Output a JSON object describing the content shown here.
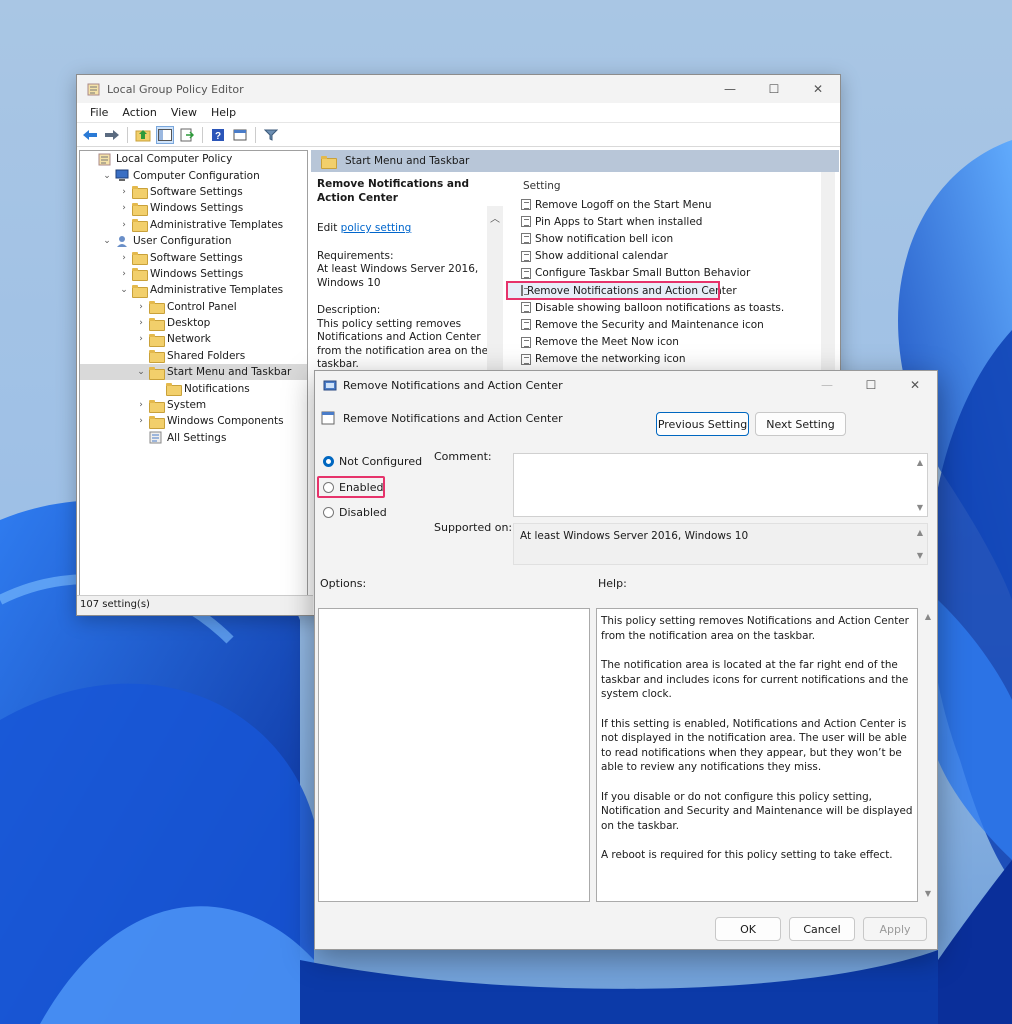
{
  "main_window": {
    "title": "Local Group Policy Editor",
    "menu": [
      "File",
      "Action",
      "View",
      "Help"
    ],
    "status": "107 setting(s)"
  },
  "tree": [
    {
      "label": "Local Computer Policy",
      "chev": "",
      "icon": "policy-icon"
    },
    {
      "label": "Computer Configuration",
      "chev": "⌄",
      "icon": "computer-icon"
    },
    {
      "label": "Software Settings",
      "chev": "›",
      "icon": "folder-icon"
    },
    {
      "label": "Windows Settings",
      "chev": "›",
      "icon": "folder-icon"
    },
    {
      "label": "Administrative Templates",
      "chev": "›",
      "icon": "folder-icon"
    },
    {
      "label": "User Configuration",
      "chev": "⌄",
      "icon": "user-icon"
    },
    {
      "label": "Software Settings",
      "chev": "›",
      "icon": "folder-icon"
    },
    {
      "label": "Windows Settings",
      "chev": "›",
      "icon": "folder-icon"
    },
    {
      "label": "Administrative Templates",
      "chev": "⌄",
      "icon": "folder-icon"
    },
    {
      "label": "Control Panel",
      "chev": "›",
      "icon": "folder-icon"
    },
    {
      "label": "Desktop",
      "chev": "›",
      "icon": "folder-icon"
    },
    {
      "label": "Network",
      "chev": "›",
      "icon": "folder-icon"
    },
    {
      "label": "Shared Folders",
      "chev": "",
      "icon": "folder-icon"
    },
    {
      "label": "Start Menu and Taskbar",
      "chev": "⌄",
      "icon": "folder-icon"
    },
    {
      "label": "Notifications",
      "chev": "",
      "icon": "folder-icon"
    },
    {
      "label": "System",
      "chev": "›",
      "icon": "folder-icon"
    },
    {
      "label": "Windows Components",
      "chev": "›",
      "icon": "folder-icon"
    },
    {
      "label": "All Settings",
      "chev": "",
      "icon": "settings-icon"
    }
  ],
  "right": {
    "header": "Start Menu and Taskbar",
    "desc_title": "Remove Notifications and Action Center",
    "edit_prefix": "Edit ",
    "edit_link": "policy setting",
    "req_label": "Requirements:",
    "req_text": "At least Windows Server 2016, Windows 10",
    "desc_label": "Description:",
    "desc_text": "This policy setting removes Notifications and Action Center from the notification area on the taskbar.",
    "list_header": "Setting",
    "settings": [
      "Remove Logoff on the Start Menu",
      "Pin Apps to Start when installed",
      "Show notification bell icon",
      "Show additional calendar",
      "Configure Taskbar Small Button Behavior",
      "Remove Notifications and Action Center",
      "Disable showing balloon notifications as toasts.",
      "Remove the Security and Maintenance icon",
      "Remove the Meet Now icon",
      "Remove the networking icon"
    ]
  },
  "dialog": {
    "title": "Remove Notifications and Action Center",
    "subtitle": "Remove Notifications and Action Center",
    "prev": "Previous Setting",
    "next": "Next Setting",
    "radios": [
      "Not Configured",
      "Enabled",
      "Disabled"
    ],
    "comment_label": "Comment:",
    "supported_label": "Supported on:",
    "supported_text": "At least Windows Server 2016, Windows 10",
    "options_label": "Options:",
    "help_label": "Help:",
    "help": [
      "This policy setting removes Notifications and Action Center from the notification area on the taskbar.",
      "The notification area is located at the far right end of the taskbar and includes icons for current notifications and the system clock.",
      "If this setting is enabled, Notifications and Action Center is not displayed in the notification area. The user will be able to read notifications when they appear, but they won’t be able to review any notifications they miss.",
      "If you disable or do not configure this policy setting, Notification and Security and Maintenance will be displayed on the taskbar.",
      "A reboot is required for this policy setting to take effect."
    ],
    "ok": "OK",
    "cancel": "Cancel",
    "apply": "Apply"
  }
}
